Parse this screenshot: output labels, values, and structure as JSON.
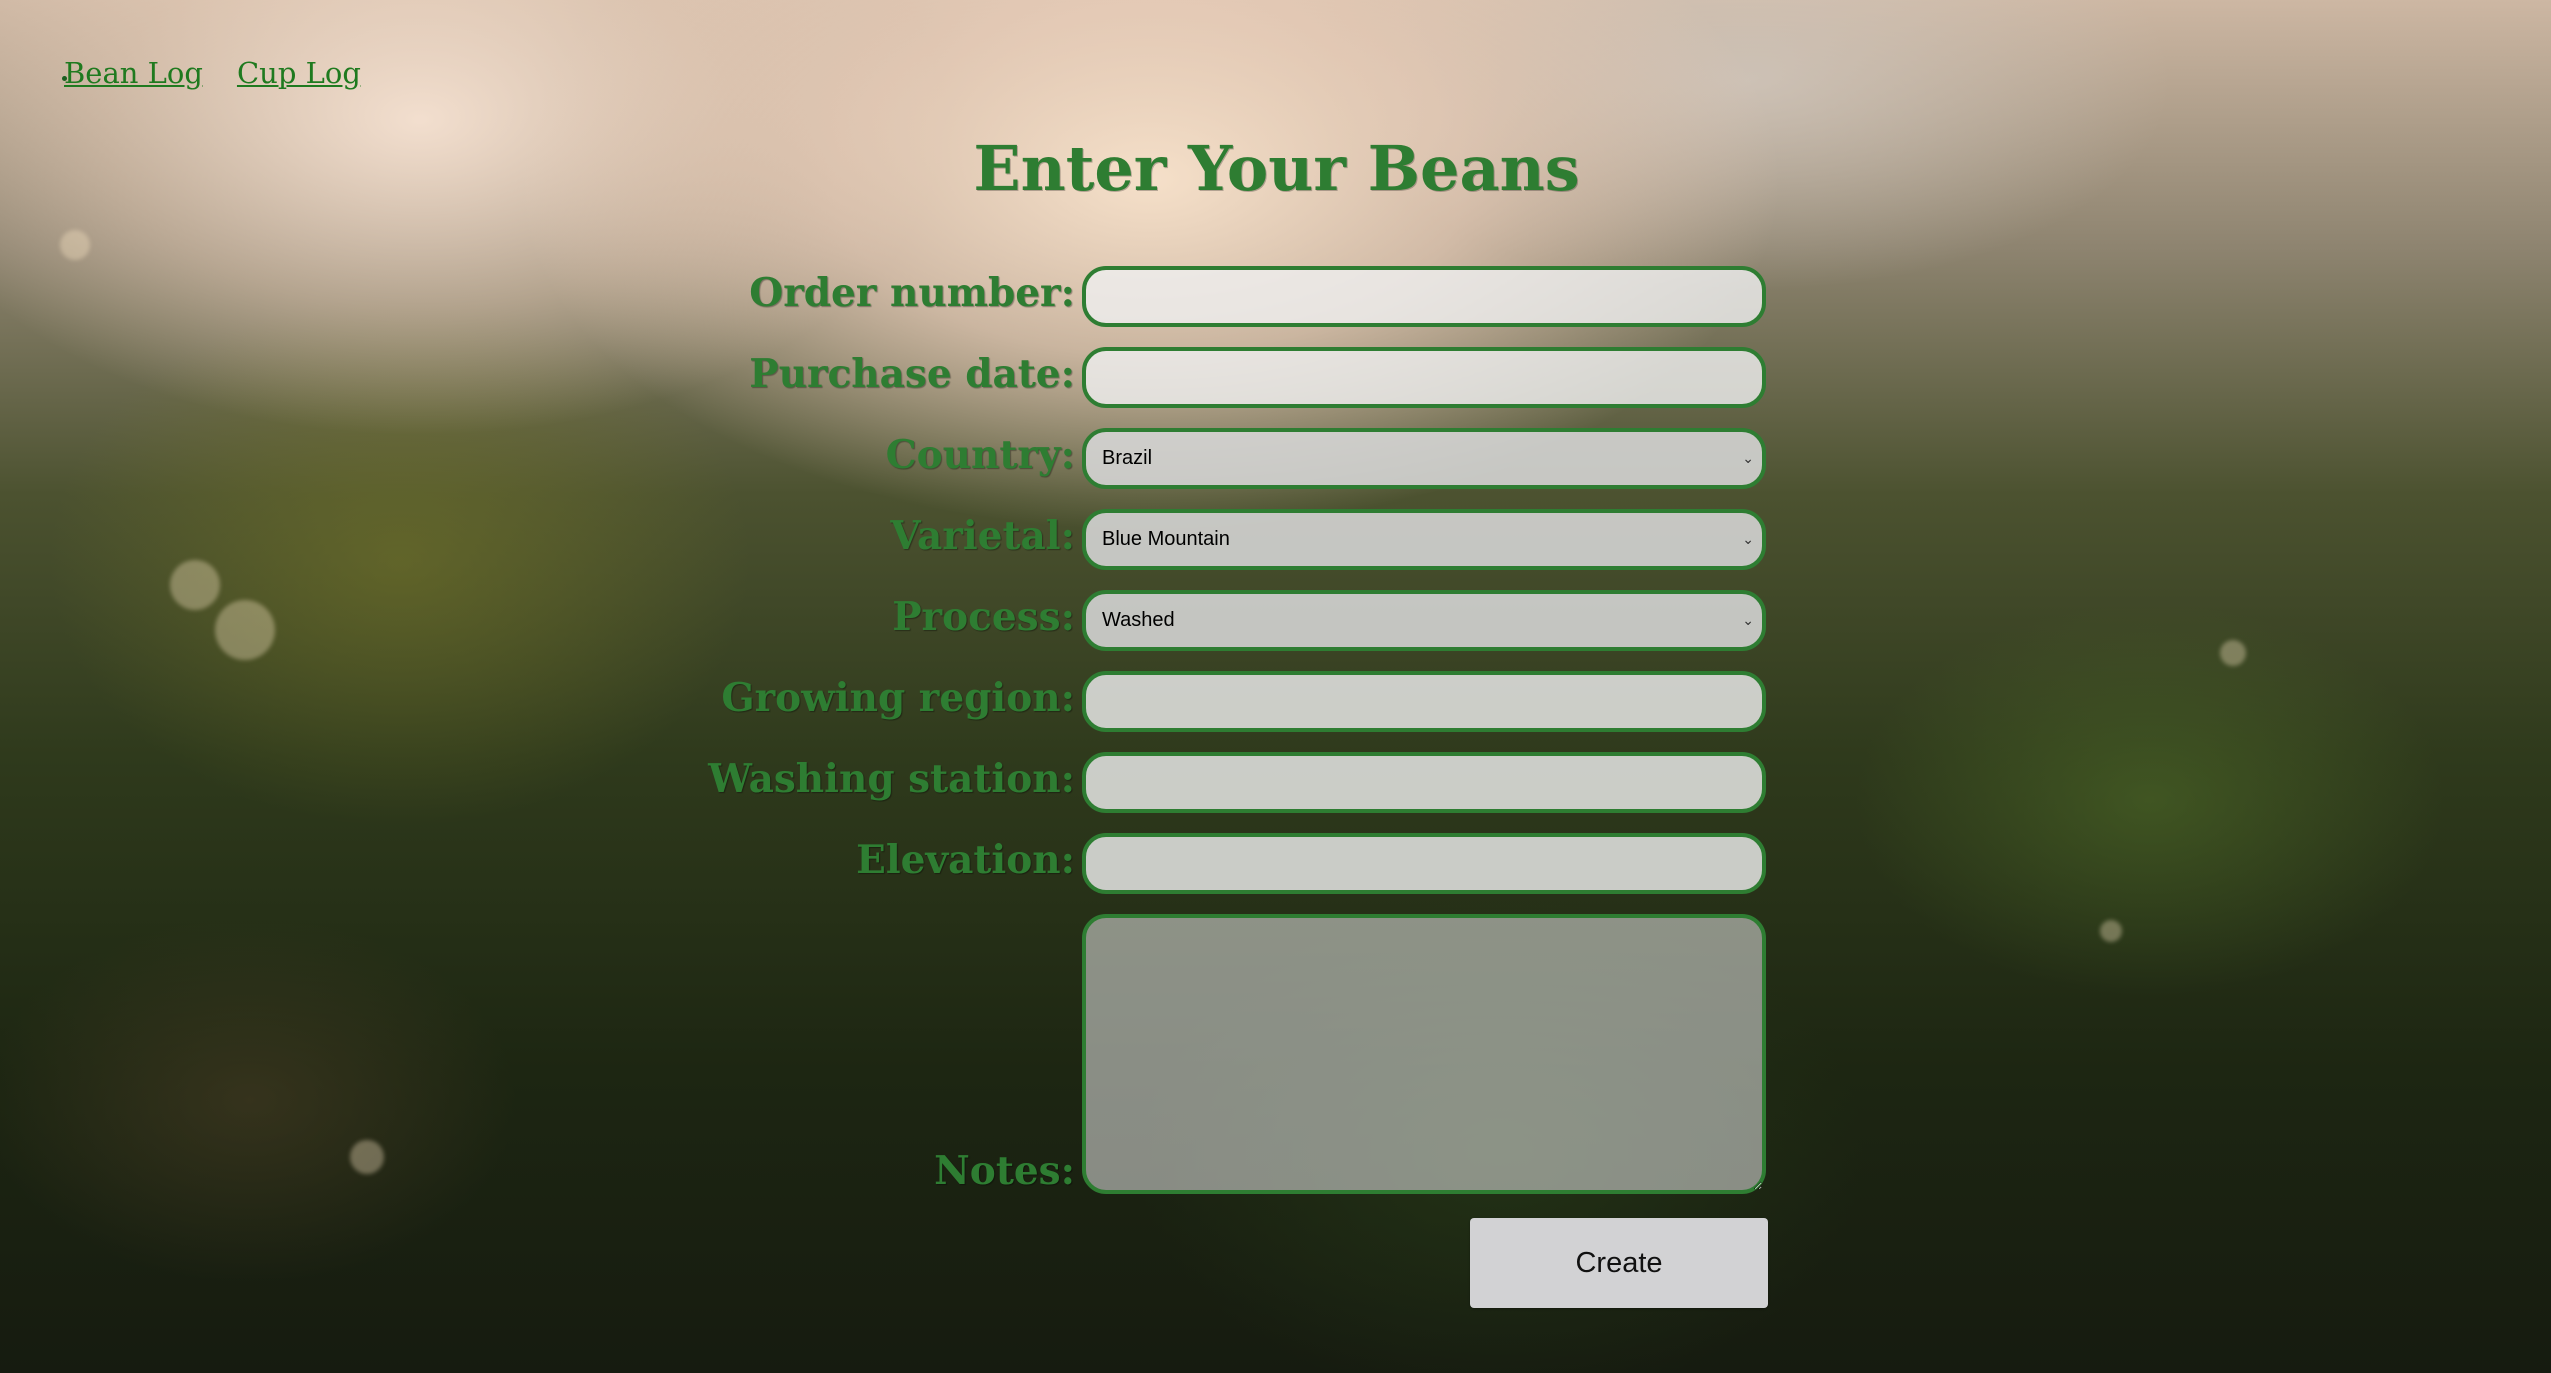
{
  "nav": {
    "links": [
      {
        "label": "Bean Log"
      },
      {
        "label": "Cup Log"
      }
    ]
  },
  "page": {
    "title": "Enter Your Beans"
  },
  "form": {
    "order_number": {
      "label": "Order number:",
      "value": ""
    },
    "purchase_date": {
      "label": "Purchase date:",
      "value": ""
    },
    "country": {
      "label": "Country:",
      "selected": "Brazil"
    },
    "varietal": {
      "label": "Varietal:",
      "selected": "Blue Mountain"
    },
    "process": {
      "label": "Process:",
      "selected": "Washed"
    },
    "growing_region": {
      "label": "Growing region:",
      "value": ""
    },
    "washing_station": {
      "label": "Washing station:",
      "value": ""
    },
    "elevation": {
      "label": "Elevation:",
      "value": ""
    },
    "notes": {
      "label": "Notes:",
      "value": ""
    },
    "submit_label": "Create"
  },
  "theme": {
    "accent": "#2e7d32",
    "link": "#1f7a1f",
    "button_bg": "#d2d2d4"
  }
}
